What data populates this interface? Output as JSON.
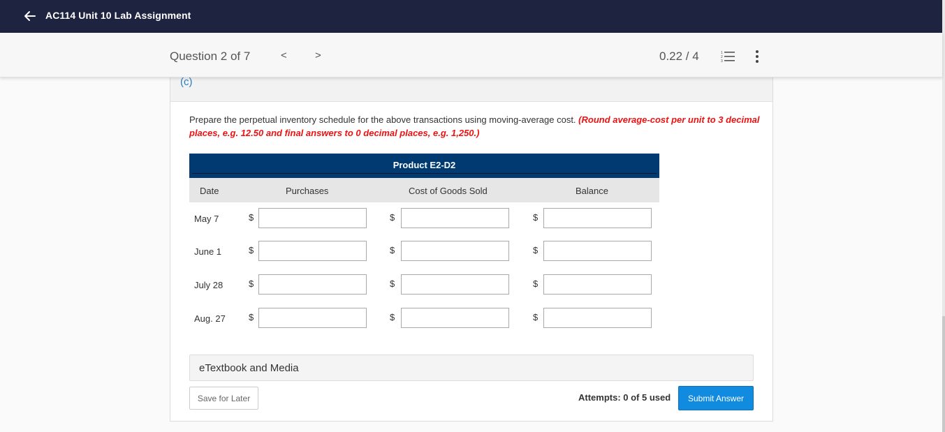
{
  "header": {
    "title": "AC114 Unit 10 Lab Assignment",
    "back_icon": "arrow-left-icon"
  },
  "question_bar": {
    "label": "Question 2 of 7",
    "prev": "<",
    "next": ">",
    "score": "0.22 / 4",
    "list_icon": "numbered-list-icon",
    "more_icon": "more-vertical-icon"
  },
  "part": {
    "label": "(c)"
  },
  "instructions": {
    "text": "Prepare the perpetual inventory schedule for the above transactions using moving-average cost. ",
    "hint": "(Round average-cost per unit to 3 decimal places, e.g. 12.50 and final answers to 0 decimal places, e.g. 1,250.)"
  },
  "table": {
    "title": "Product E2-D2",
    "columns": [
      "Date",
      "Purchases",
      "Cost of Goods Sold",
      "Balance"
    ],
    "currency": "$",
    "rows": [
      {
        "date": "May 7",
        "purchases": "",
        "cogs": "",
        "balance": ""
      },
      {
        "date": "June 1",
        "purchases": "",
        "cogs": "",
        "balance": ""
      },
      {
        "date": "July 28",
        "purchases": "",
        "cogs": "",
        "balance": ""
      },
      {
        "date": "Aug. 27",
        "purchases": "",
        "cogs": "",
        "balance": ""
      }
    ]
  },
  "etextbook": {
    "label": "eTextbook and Media"
  },
  "footer": {
    "save_label": "Save for Later",
    "attempts": "Attempts: 0 of 5 used",
    "submit_label": "Submit Answer"
  },
  "colors": {
    "topbar": "#1e2340",
    "table_header": "#003a70",
    "submit": "#118be0",
    "hint": "#ee1111",
    "part_label": "#2a7fc1"
  }
}
